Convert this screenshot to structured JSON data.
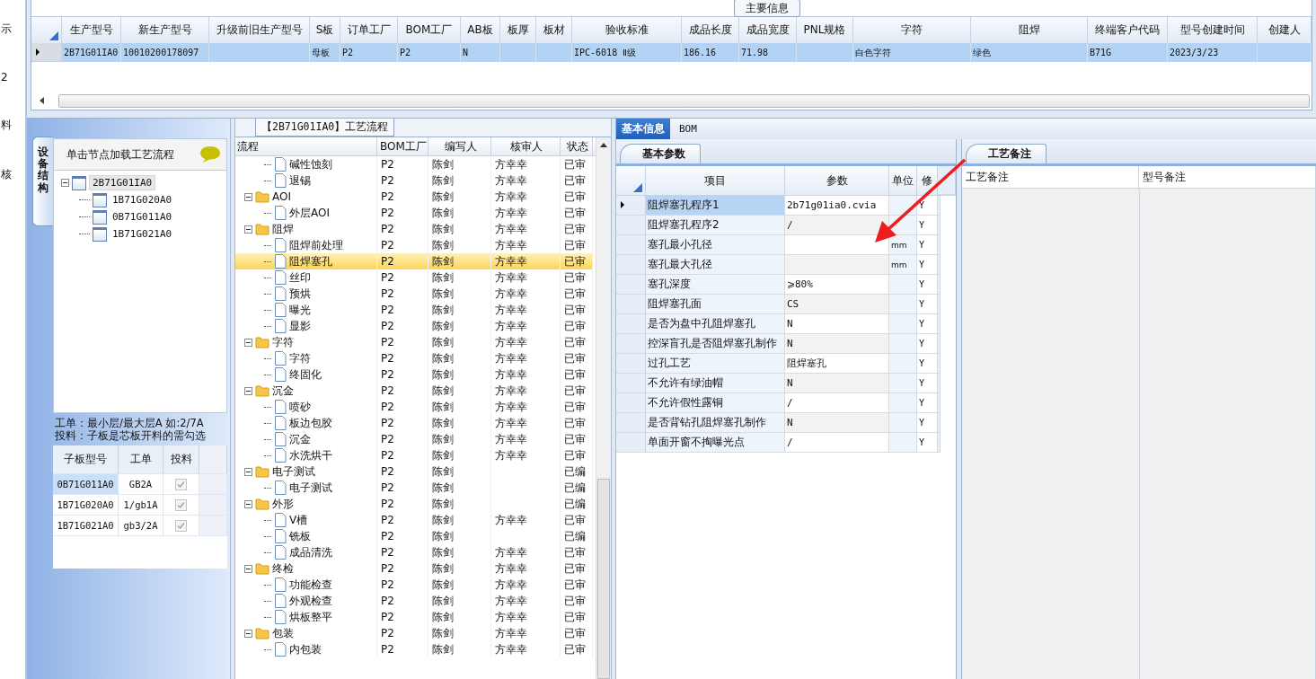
{
  "left_strip": [
    "示",
    "2",
    "料",
    "核"
  ],
  "main_info": {
    "tab": "主要信息",
    "columns": [
      "生产型号",
      "新生产型号",
      "升级前旧生产型号",
      "S板",
      "订单工厂",
      "BOM工厂",
      "AB板",
      "板厚",
      "板材",
      "验收标准",
      "成品长度",
      "成品宽度",
      "PNL规格",
      "字符",
      "阻焊",
      "终端客户代码",
      "型号创建时间",
      "创建人"
    ],
    "rows": [
      {
        "selected": true,
        "cells": [
          "2B71G01IA0",
          "10010200178097",
          "",
          "母板",
          "P2",
          "P2",
          "N",
          "",
          "",
          "IPC-6018 Ⅱ级",
          "186.16",
          "71.98",
          "",
          "白色字符",
          "绿色",
          "B71G",
          "2023/3/23",
          ""
        ]
      }
    ]
  },
  "structure": {
    "tab": "设备结构",
    "hint": "单击节点加载工艺流程",
    "tree": {
      "label": "2B71G01IA0",
      "selected": true,
      "expanded": true,
      "children": [
        {
          "label": "1B71G020A0",
          "selected": false
        },
        {
          "label": "0B71G011A0",
          "selected": false
        },
        {
          "label": "1B71G021A0",
          "selected": false
        }
      ]
    },
    "notes": [
      "工单：最小层/最大层A 如:2/7A",
      "投料：子板是芯板开料的需勾选"
    ],
    "table": {
      "columns": [
        "子板型号",
        "工单",
        "投料"
      ],
      "rows": [
        {
          "cells": [
            "0B71G011A0",
            "GB2A"
          ],
          "checked": true,
          "selected": true
        },
        {
          "cells": [
            "1B71G020A0",
            "1/gb1A"
          ],
          "checked": true,
          "selected": false
        },
        {
          "cells": [
            "1B71G021A0",
            "gb3/2A"
          ],
          "checked": true,
          "selected": false
        }
      ]
    }
  },
  "flow": {
    "title": "【2B71G01IA0】工艺流程",
    "columns": [
      "流程",
      "BOM工厂",
      "编写人",
      "核审人",
      "状态"
    ],
    "rows": [
      {
        "children": [
          {
            "kind": "leaf",
            "label": "碱性蚀刻",
            "cells": [
              "P2",
              "陈剑",
              "方幸幸",
              "已审"
            ],
            "selected": false
          },
          {
            "kind": "leaf",
            "label": "退锡",
            "cells": [
              "P2",
              "陈剑",
              "方幸幸",
              "已审"
            ],
            "selected": false
          }
        ]
      },
      {
        "kind": "folder",
        "label": "AOI",
        "cells": [
          "P2",
          "陈剑",
          "方幸幸",
          "已审"
        ],
        "expanded": true,
        "selected": false,
        "children": [
          {
            "kind": "leaf",
            "label": "外层AOI",
            "cells": [
              "P2",
              "陈剑",
              "方幸幸",
              "已审"
            ],
            "selected": false
          }
        ]
      },
      {
        "kind": "folder",
        "label": "阻焊",
        "cells": [
          "P2",
          "陈剑",
          "方幸幸",
          "已审"
        ],
        "expanded": true,
        "selected": false,
        "children": [
          {
            "kind": "leaf",
            "label": "阻焊前处理",
            "cells": [
              "P2",
              "陈剑",
              "方幸幸",
              "已审"
            ],
            "selected": false
          },
          {
            "kind": "leaf",
            "label": "阻焊塞孔",
            "cells": [
              "P2",
              "陈剑",
              "方幸幸",
              "已审"
            ],
            "selected": true
          },
          {
            "kind": "leaf",
            "label": "丝印",
            "cells": [
              "P2",
              "陈剑",
              "方幸幸",
              "已审"
            ],
            "selected": false
          },
          {
            "kind": "leaf",
            "label": "预烘",
            "cells": [
              "P2",
              "陈剑",
              "方幸幸",
              "已审"
            ],
            "selected": false
          },
          {
            "kind": "leaf",
            "label": "曝光",
            "cells": [
              "P2",
              "陈剑",
              "方幸幸",
              "已审"
            ],
            "selected": false
          },
          {
            "kind": "leaf",
            "label": "显影",
            "cells": [
              "P2",
              "陈剑",
              "方幸幸",
              "已审"
            ],
            "selected": false
          }
        ]
      },
      {
        "kind": "folder",
        "label": "字符",
        "cells": [
          "P2",
          "陈剑",
          "方幸幸",
          "已审"
        ],
        "expanded": true,
        "selected": false,
        "children": [
          {
            "kind": "leaf",
            "label": "字符",
            "cells": [
              "P2",
              "陈剑",
              "方幸幸",
              "已审"
            ],
            "selected": false
          },
          {
            "kind": "leaf",
            "label": "终固化",
            "cells": [
              "P2",
              "陈剑",
              "方幸幸",
              "已审"
            ],
            "selected": false
          }
        ]
      },
      {
        "kind": "folder",
        "label": "沉金",
        "cells": [
          "P2",
          "陈剑",
          "方幸幸",
          "已审"
        ],
        "expanded": true,
        "selected": false,
        "children": [
          {
            "kind": "leaf",
            "label": "喷砂",
            "cells": [
              "P2",
              "陈剑",
              "方幸幸",
              "已审"
            ],
            "selected": false
          },
          {
            "kind": "leaf",
            "label": "板边包胶",
            "cells": [
              "P2",
              "陈剑",
              "方幸幸",
              "已审"
            ],
            "selected": false
          },
          {
            "kind": "leaf",
            "label": "沉金",
            "cells": [
              "P2",
              "陈剑",
              "方幸幸",
              "已审"
            ],
            "selected": false
          },
          {
            "kind": "leaf",
            "label": "水洗烘干",
            "cells": [
              "P2",
              "陈剑",
              "方幸幸",
              "已审"
            ],
            "selected": false
          }
        ]
      },
      {
        "kind": "folder",
        "label": "电子测试",
        "cells": [
          "P2",
          "陈剑",
          "",
          "已编"
        ],
        "expanded": true,
        "selected": false,
        "children": [
          {
            "kind": "leaf",
            "label": "电子测试",
            "cells": [
              "P2",
              "陈剑",
              "",
              "已编"
            ],
            "selected": false
          }
        ]
      },
      {
        "kind": "folder",
        "label": "外形",
        "cells": [
          "P2",
          "陈剑",
          "",
          "已编"
        ],
        "expanded": true,
        "selected": false,
        "children": [
          {
            "kind": "leaf",
            "label": "V槽",
            "cells": [
              "P2",
              "陈剑",
              "方幸幸",
              "已审"
            ],
            "selected": false
          },
          {
            "kind": "leaf",
            "label": "铣板",
            "cells": [
              "P2",
              "陈剑",
              "",
              "已编"
            ],
            "selected": false
          },
          {
            "kind": "leaf",
            "label": "成品清洗",
            "cells": [
              "P2",
              "陈剑",
              "方幸幸",
              "已审"
            ],
            "selected": false
          }
        ]
      },
      {
        "kind": "folder",
        "label": "终检",
        "cells": [
          "P2",
          "陈剑",
          "方幸幸",
          "已审"
        ],
        "expanded": true,
        "selected": false,
        "children": [
          {
            "kind": "leaf",
            "label": "功能检查",
            "cells": [
              "P2",
              "陈剑",
              "方幸幸",
              "已审"
            ],
            "selected": false
          },
          {
            "kind": "leaf",
            "label": "外观检查",
            "cells": [
              "P2",
              "陈剑",
              "方幸幸",
              "已审"
            ],
            "selected": false
          },
          {
            "kind": "leaf",
            "label": "烘板整平",
            "cells": [
              "P2",
              "陈剑",
              "方幸幸",
              "已审"
            ],
            "selected": false
          }
        ]
      },
      {
        "kind": "folder",
        "label": "包装",
        "cells": [
          "P2",
          "陈剑",
          "方幸幸",
          "已审"
        ],
        "expanded": true,
        "selected": false,
        "children": [
          {
            "kind": "leaf",
            "label": "内包装",
            "cells": [
              "P2",
              "陈剑",
              "方幸幸",
              "已审"
            ],
            "selected": false
          }
        ]
      }
    ]
  },
  "detail": {
    "tabs": [
      {
        "label": "基本信息",
        "selected": true
      },
      {
        "label": "BOM",
        "selected": false
      }
    ],
    "params": {
      "tab": "基本参数",
      "columns": [
        "项目",
        "参数",
        "单位",
        "修"
      ],
      "rows": [
        {
          "item": "阻焊塞孔程序1",
          "value": "2b71g01ia0.cvia",
          "unit": "",
          "edit": "Y",
          "selected": true
        },
        {
          "item": "阻焊塞孔程序2",
          "value": "/",
          "unit": "",
          "edit": "Y",
          "selected": false
        },
        {
          "item": "塞孔最小孔径",
          "value": "",
          "unit": "mm",
          "edit": "Y",
          "selected": false
        },
        {
          "item": "塞孔最大孔径",
          "value": "",
          "unit": "mm",
          "edit": "Y",
          "selected": false
        },
        {
          "item": "塞孔深度",
          "value": "⩾80%",
          "unit": "",
          "edit": "Y",
          "selected": false
        },
        {
          "item": "阻焊塞孔面",
          "value": "CS",
          "unit": "",
          "edit": "Y",
          "selected": false
        },
        {
          "item": "是否为盘中孔阻焊塞孔",
          "value": "N",
          "unit": "",
          "edit": "Y",
          "selected": false
        },
        {
          "item": "控深盲孔是否阻焊塞孔制作",
          "value": "N",
          "unit": "",
          "edit": "Y",
          "selected": false
        },
        {
          "item": "过孔工艺",
          "value": "阻焊塞孔",
          "unit": "",
          "edit": "Y",
          "selected": false
        },
        {
          "item": "不允许有绿油帽",
          "value": "N",
          "unit": "",
          "edit": "Y",
          "selected": false
        },
        {
          "item": "不允许假性露铜",
          "value": "/",
          "unit": "",
          "edit": "Y",
          "selected": false
        },
        {
          "item": "是否背钻孔阻焊塞孔制作",
          "value": "N",
          "unit": "",
          "edit": "Y",
          "selected": false
        },
        {
          "item": "单面开窗不掏曝光点",
          "value": "/",
          "unit": "",
          "edit": "Y",
          "selected": false
        }
      ]
    },
    "remarks": {
      "tab": "工艺备注",
      "columns": [
        "工艺备注",
        "型号备注"
      ]
    }
  }
}
